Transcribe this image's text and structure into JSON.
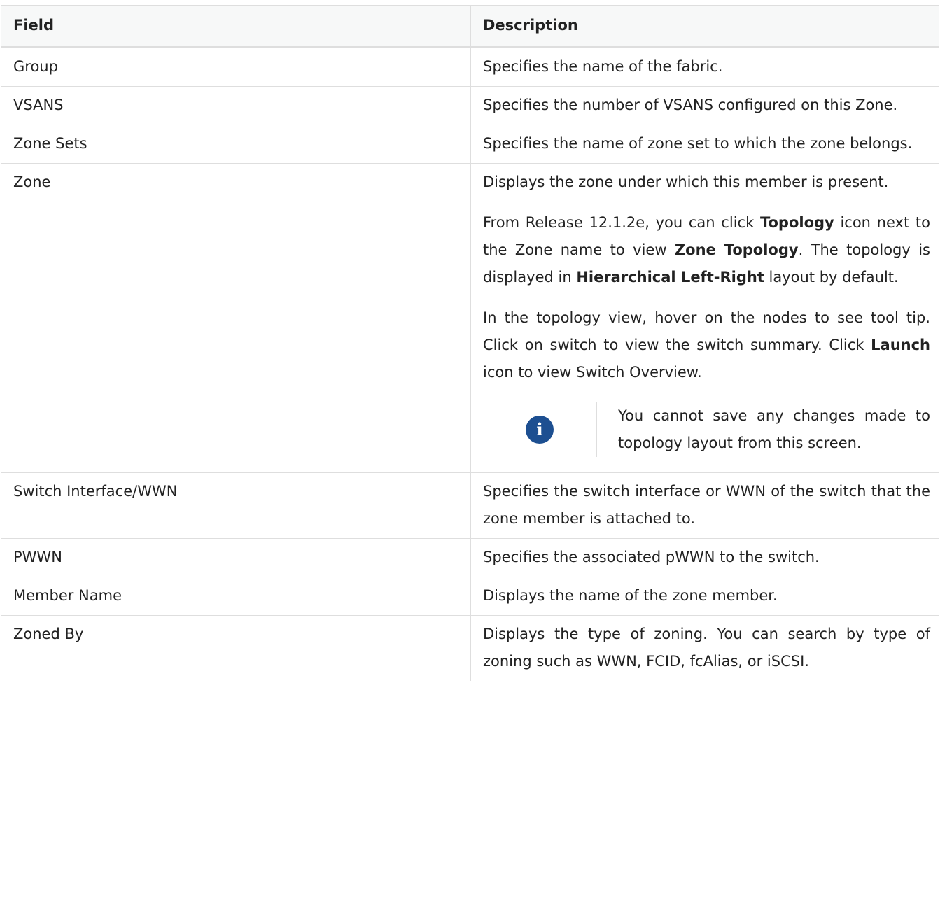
{
  "table": {
    "headers": [
      "Field",
      "Description"
    ],
    "rows": [
      {
        "field": "Group",
        "desc": "Specifies the name of the fabric."
      },
      {
        "field": "VSANS",
        "desc": "Specifies the number of VSANS configured on this Zone."
      },
      {
        "field": "Zone Sets",
        "desc": "Specifies the name of zone set to which the zone belongs."
      },
      {
        "field": "Zone",
        "desc": "Displays the zone under which this member is present.",
        "p2": {
          "a": "From Release 12.1.2e, you can click ",
          "b1": "Topology",
          "c": " icon next to the Zone name to view ",
          "b2": "Zone Topology",
          "d": ". The topology is displayed in ",
          "b3": "Hierarchical Left-Right",
          "e": " layout by default."
        },
        "p3": {
          "a": "In the topology view, hover on the nodes to see tool tip. Click on switch to view the switch summary. Click ",
          "b1": "Launch",
          "c": " icon to view Switch Overview."
        },
        "note": "You cannot save any changes made to topology layout from this screen.",
        "note_icon": "info-icon"
      },
      {
        "field": "Switch Interface/WWN",
        "desc": "Specifies the switch interface or WWN of the switch that the zone member is attached to."
      },
      {
        "field": "PWWN",
        "desc": "Specifies the associated pWWN to the switch."
      },
      {
        "field": "Member Name",
        "desc": "Displays the name of the zone member."
      },
      {
        "field": "Zoned By",
        "desc": "Displays the type of zoning. You can search by type of zoning such as WWN, FCID, fcAlias, or iSCSI."
      }
    ]
  },
  "colors": {
    "note_icon_bg": "#1d4f91",
    "border": "#dedede",
    "header_bg": "#f7f8f8"
  }
}
